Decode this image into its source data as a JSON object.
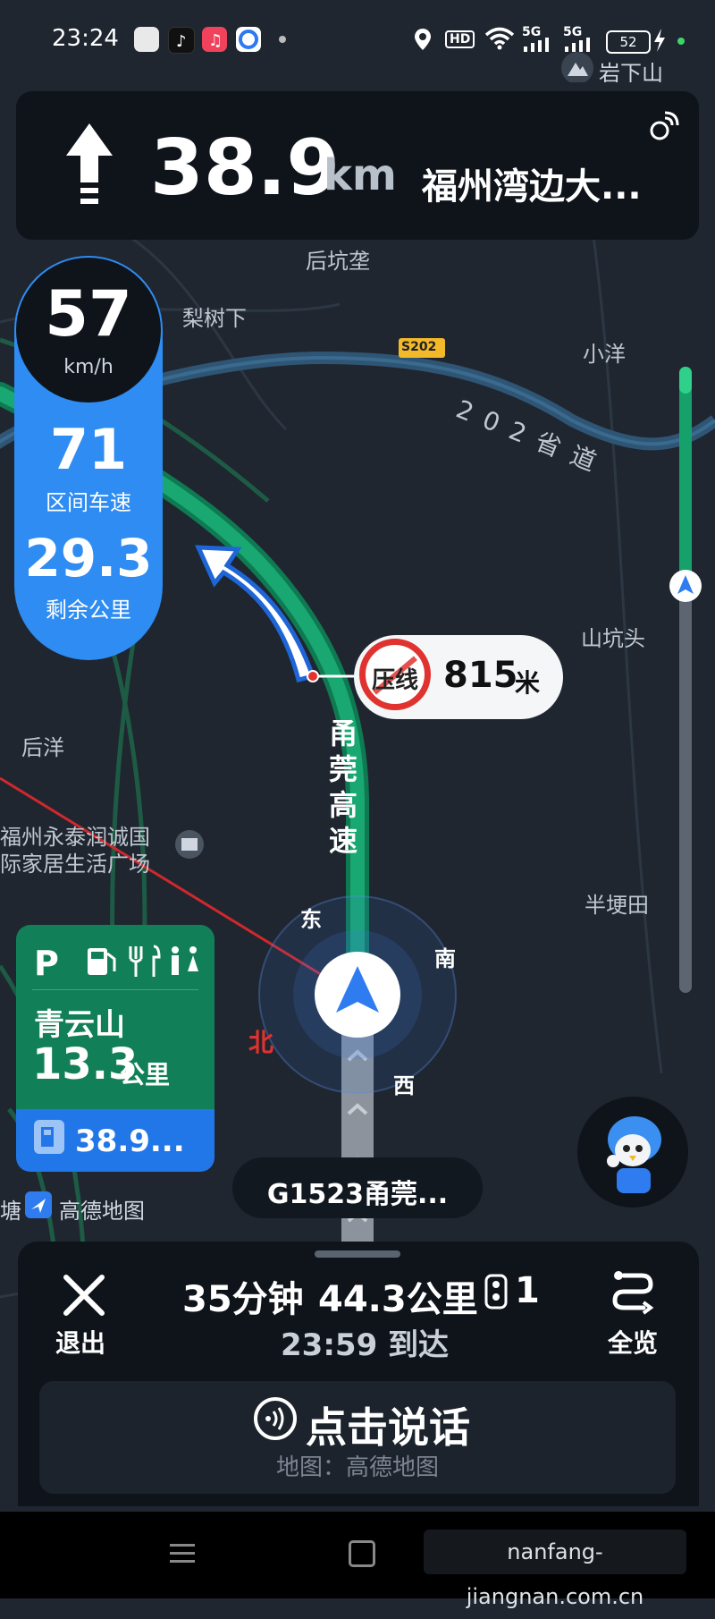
{
  "status_bar": {
    "time": "23:24",
    "app_icons": [
      "news-app-icon",
      "tiktok-icon",
      "music-icon",
      "browser-icon"
    ],
    "indicators": [
      "location-icon",
      "HD",
      "wifi-icon",
      "5G",
      "5G"
    ],
    "battery": "52",
    "location_name": "岩下山"
  },
  "nav_card": {
    "distance": "38.9",
    "unit": "km",
    "road": "福州湾边大..."
  },
  "speed": {
    "current": "57",
    "unit": "km/h",
    "avg": "71",
    "avg_label": "区间车速",
    "remaining": "29.3",
    "remaining_label": "剩余公里"
  },
  "warning": {
    "sign_text": "压线",
    "distance": "815",
    "unit": "米"
  },
  "map_labels": {
    "l1": "后坑垄",
    "l2": "梨树下",
    "l3": "小洋",
    "l4": "202省道",
    "l5": "S202",
    "l6": "山坑头",
    "l7": "后洋",
    "l8": "福州永泰润诚国",
    "l9": "际家居生活广场",
    "l10": "半埂田",
    "l11": "甬莞高速",
    "compass_e": "东",
    "compass_s": "南",
    "compass_w": "西",
    "compass_n": "北",
    "brand": "高德地图",
    "tang": "塘"
  },
  "service_area": {
    "name": "青云山",
    "distance": "13.3",
    "unit": "公里",
    "next": "38.9..."
  },
  "current_road": "G1523甬莞...",
  "bottom": {
    "exit_label": "退出",
    "time_left": "35分钟",
    "distance_left": "44.3公里",
    "lights": "1",
    "arrival": "23:59 到达",
    "overview_label": "全览",
    "voice_label": "点击说话",
    "voice_sub": "地图：高德地图"
  },
  "watermark": "nanfang-jiangnan.com.cn",
  "colors": {
    "map_bg": "#1f2630",
    "route_green": "#12a36b",
    "speed_blue": "#2e8cf2",
    "service_green": "#118059",
    "warning_red": "#e0322f"
  }
}
